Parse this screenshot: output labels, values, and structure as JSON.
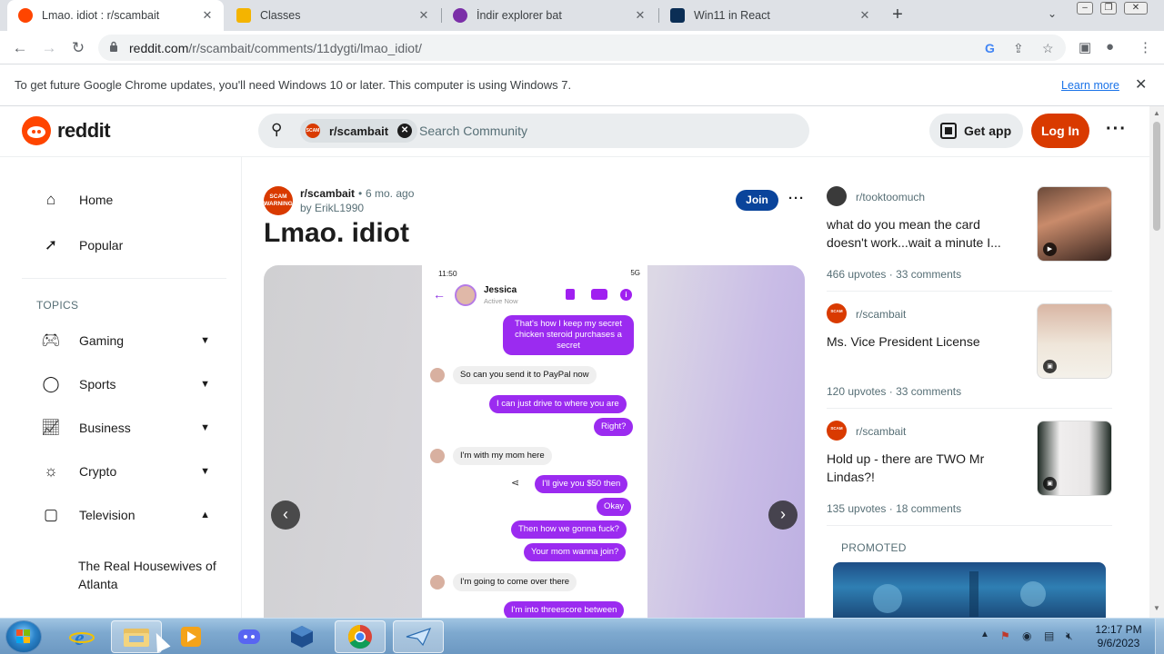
{
  "browser": {
    "tabs": [
      {
        "title": "Lmao. idiot : r/scambait",
        "icon": "reddit-favicon",
        "active": true
      },
      {
        "title": "Classes",
        "icon": "google-classroom-favicon",
        "active": false
      },
      {
        "title": "İndir explorer bat",
        "icon": "bing-favicon",
        "active": false
      },
      {
        "title": "Win11 in React",
        "icon": "win11-favicon",
        "active": false
      }
    ],
    "new_tab": "+",
    "url_host": "reddit.com",
    "url_path": "/r/scambait/comments/11dygti/lmao_idiot/",
    "infobar": {
      "message": "To get future Google Chrome updates, you'll need Windows 10 or later. This computer is using Windows 7.",
      "link": "Learn more"
    }
  },
  "reddit": {
    "wordmark": "reddit",
    "search": {
      "community_chip": "r/scambait",
      "community_avatar": "SCAM",
      "placeholder": "Search Community"
    },
    "get_app": "Get app",
    "login": "Log In",
    "colors": {
      "brand": "#ff4500",
      "login": "#d93a00",
      "join": "#0a449b"
    }
  },
  "sidebar": {
    "items": [
      {
        "label": "Home",
        "icon": "home-icon"
      },
      {
        "label": "Popular",
        "icon": "popular-icon"
      }
    ],
    "topics_label": "TOPICS",
    "topics": [
      {
        "label": "Gaming",
        "icon": "gamepad-icon",
        "expanded": false
      },
      {
        "label": "Sports",
        "icon": "sports-ball-icon",
        "expanded": false
      },
      {
        "label": "Business",
        "icon": "chart-icon",
        "expanded": false
      },
      {
        "label": "Crypto",
        "icon": "sun-gear-icon",
        "expanded": false
      },
      {
        "label": "Television",
        "icon": "tv-icon",
        "expanded": true
      }
    ],
    "subtopic": "The Real Housewives of Atlanta"
  },
  "post": {
    "subreddit": "r/scambait",
    "avatar_text": "SCAM WARNING",
    "separator": "•",
    "age": "6 mo. ago",
    "author": "by ErikL1990",
    "join": "Join",
    "title": "Lmao. idiot",
    "screenshot": {
      "status_time": "11:50",
      "status_right": "5G",
      "contact_name": "Jessica",
      "contact_status": "Active Now",
      "messages": [
        {
          "from": "out",
          "text": "That's how I keep my secret chicken steroid purchases a secret"
        },
        {
          "from": "in",
          "text": "So can you send it to PayPal now"
        },
        {
          "from": "out",
          "text": "I can just drive to where you are"
        },
        {
          "from": "out",
          "text": "Right?"
        },
        {
          "from": "in",
          "text": "I'm with my mom here"
        },
        {
          "from": "out",
          "text": "I'll give you $50 then"
        },
        {
          "from": "out",
          "text": "Okay"
        },
        {
          "from": "out",
          "text": "Then how we gonna fuck?"
        },
        {
          "from": "out",
          "text": "Your mom wanna join?"
        },
        {
          "from": "in",
          "text": "I'm going to come over there"
        },
        {
          "from": "out",
          "text": "I'm into threescore between"
        }
      ]
    }
  },
  "feed": {
    "cards": [
      {
        "sub": "r/tooktoomuch",
        "title": "what do you mean the card doesn't work...wait a minute I...",
        "upvotes": "466 upvotes",
        "comments": "33 comments",
        "thumb": "video"
      },
      {
        "sub": "r/scambait",
        "title": "Ms. Vice President License",
        "upvotes": "120 upvotes",
        "comments": "33 comments",
        "thumb": "gallery"
      },
      {
        "sub": "r/scambait",
        "title": "Hold up - there are TWO Mr Lindas?!",
        "upvotes": "135 upvotes",
        "comments": "18 comments",
        "thumb": "gallery"
      }
    ],
    "meta_sep": "·",
    "promoted": "PROMOTED"
  },
  "taskbar": {
    "apps": [
      "explorer-ie",
      "file-explorer",
      "media-player",
      "discord",
      "virtualbox",
      "chrome",
      "email"
    ],
    "clock_time": "12:17 PM",
    "clock_date": "9/6/2023"
  }
}
